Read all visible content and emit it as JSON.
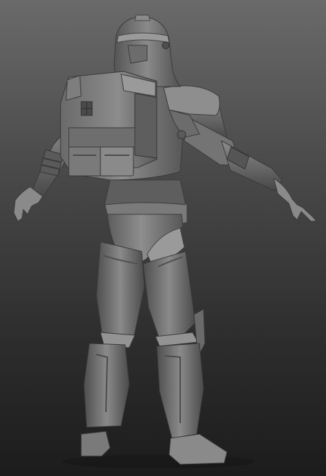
{
  "scene": {
    "subject": "armored-trooper-back-view",
    "material_colors": {
      "base": "#7c7c7c",
      "light": "#a8a8a8",
      "mid": "#666666",
      "dark": "#3e3e3e",
      "shadow": "#2a2a2a",
      "background_top": "#6a6a6a",
      "background_bottom": "#1c1c1c"
    }
  }
}
